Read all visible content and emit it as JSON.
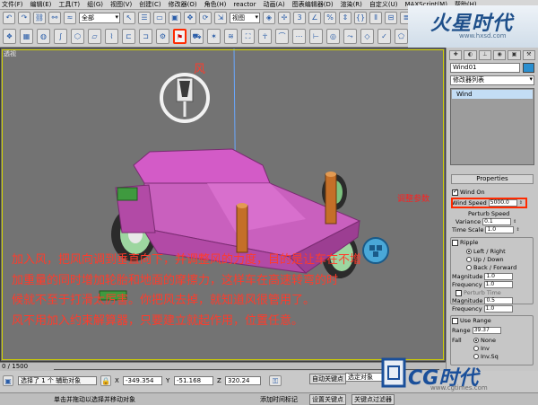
{
  "menu": {
    "items": [
      "文件(F)",
      "编辑(E)",
      "工具(T)",
      "组(G)",
      "视图(V)",
      "创建(C)",
      "修改器(O)",
      "角色(H)",
      "reactor",
      "动画(A)",
      "图表编辑器(D)",
      "渲染(R)",
      "自定义(U)",
      "MAXScript(M)",
      "帮助(H)"
    ]
  },
  "toolbar": {
    "selection_filter": "全部",
    "ref_coord": "视图"
  },
  "logo": {
    "text": "火星时代",
    "url": "www.hxsd.com"
  },
  "viewport": {
    "label": "透视",
    "wind_label": "风",
    "description_lines": [
      "加入风，把风向调到垂直向下，并调整风的力度，目的是让车在不增",
      "加重量的同时增加轮胎和地面的摩擦力，这样车在高速转弯的时",
      "候就不至于打滑太厉害。你把风去掉，就知道风很管用了。",
      "风不用加入约束解算器，只要建立就起作用，位置任意。"
    ]
  },
  "panel": {
    "object_name": "Wind01",
    "modifier_list": "修改器列表",
    "stack_item": "Wind",
    "properties_title": "Properties",
    "wind_on": {
      "label": "Wind On",
      "checked": true
    },
    "wind_speed": {
      "label": "Wind Speed",
      "value": "5000.0"
    },
    "perturb_speed": {
      "label": "Perturb Speed"
    },
    "variance": {
      "label": "Variance",
      "value": "0.1"
    },
    "time_scale": {
      "label": "Time Scale",
      "value": "1.0"
    },
    "ripple": {
      "label": "Ripple",
      "checked": false
    },
    "ripple_options": [
      "Left / Right",
      "Up / Down",
      "Back / Forward"
    ],
    "ripple_selected": 0,
    "magnitude1": {
      "label": "Magnitude",
      "value": "1.0"
    },
    "frequency1": {
      "label": "Frequency",
      "value": "1.0"
    },
    "perturb_time": {
      "label": "Perturb Time",
      "checked": false
    },
    "magnitude2": {
      "label": "Magnitude",
      "value": "0.5"
    },
    "frequency2": {
      "label": "Frequency",
      "value": "1.0"
    },
    "use_range": {
      "label": "Use Range",
      "checked": false
    },
    "range": {
      "label": "Range",
      "value": "39.37"
    },
    "fall": {
      "label": "Fall"
    },
    "fall_options": [
      "None",
      "Inv",
      "Inv.Sq"
    ],
    "fall_selected": 0
  },
  "annotations": {
    "adjust_params": "调整参数"
  },
  "timeline": {
    "frame_text": "0 / 1500"
  },
  "status": {
    "selected": "选择了 1 个 辅助对象",
    "x_label": "X",
    "x_value": "-349.354",
    "y_label": "Y",
    "y_value": "-51.168",
    "z_label": "Z",
    "z_value": "320.24",
    "auto_key": "自动关键点",
    "selected_obj": "选定对象",
    "set_key": "设置关键点",
    "key_filter": "关键点过滤器",
    "prompt": "单击并拖动以选择并移动对象",
    "add_time_tag": "添加时间标记"
  },
  "watermark": {
    "text": "CG时代",
    "url": "www.cgtimes.com"
  }
}
